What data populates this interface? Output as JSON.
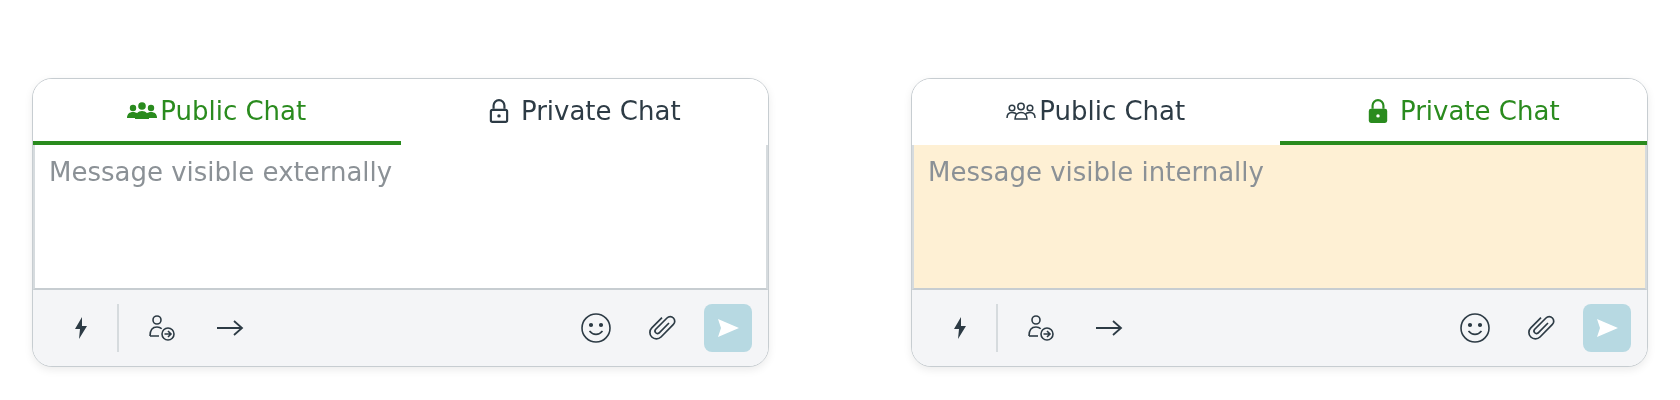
{
  "composers": [
    {
      "tabs": [
        {
          "kind": "public",
          "label": "Public Chat",
          "selected": true
        },
        {
          "kind": "private",
          "label": "Private Chat",
          "selected": false
        }
      ],
      "message": {
        "placeholder": "Message visible externally"
      },
      "send": {
        "disabled": true
      }
    },
    {
      "tabs": [
        {
          "kind": "public",
          "label": "Public Chat",
          "selected": false
        },
        {
          "kind": "private",
          "label": "Private Chat",
          "selected": true
        }
      ],
      "message": {
        "placeholder": "Message visible internally"
      },
      "send": {
        "disabled": true
      }
    }
  ]
}
